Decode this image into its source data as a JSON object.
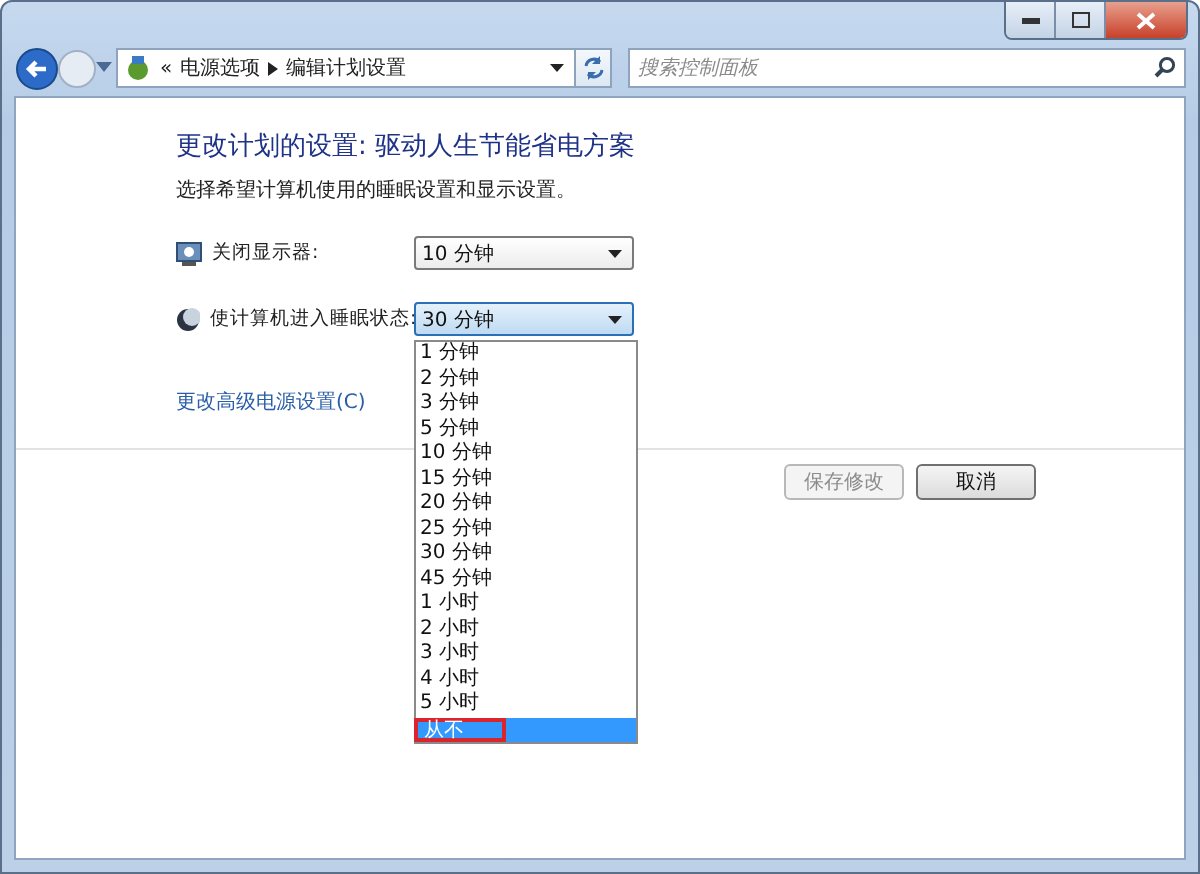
{
  "address_bar": {
    "overflow": "«",
    "crumbs": [
      "电源选项",
      "编辑计划设置"
    ]
  },
  "search": {
    "placeholder": "搜索控制面板"
  },
  "heading": "更改计划的设置: 驱动人生节能省电方案",
  "subtitle": "选择希望计算机使用的睡眠设置和显示设置。",
  "settings": [
    {
      "kind": "display",
      "label": "关闭显示器:",
      "value": "10 分钟",
      "focused": false
    },
    {
      "kind": "sleep",
      "label": "使计算机进入睡眠状态:",
      "value": "30 分钟",
      "focused": true
    }
  ],
  "dropdown": {
    "options": [
      {
        "label": "1 分钟",
        "selected": false,
        "outlined": false
      },
      {
        "label": "2 分钟",
        "selected": false,
        "outlined": false
      },
      {
        "label": "3 分钟",
        "selected": false,
        "outlined": false
      },
      {
        "label": "5 分钟",
        "selected": false,
        "outlined": false
      },
      {
        "label": "10 分钟",
        "selected": false,
        "outlined": false
      },
      {
        "label": "15 分钟",
        "selected": false,
        "outlined": false
      },
      {
        "label": "20 分钟",
        "selected": false,
        "outlined": false
      },
      {
        "label": "25 分钟",
        "selected": false,
        "outlined": false
      },
      {
        "label": "30 分钟",
        "selected": false,
        "outlined": false
      },
      {
        "label": "45 分钟",
        "selected": false,
        "outlined": false
      },
      {
        "label": "1 小时",
        "selected": false,
        "outlined": false
      },
      {
        "label": "2 小时",
        "selected": false,
        "outlined": false
      },
      {
        "label": "3 小时",
        "selected": false,
        "outlined": false
      },
      {
        "label": "4 小时",
        "selected": false,
        "outlined": false
      },
      {
        "label": "5 小时",
        "selected": false,
        "outlined": false
      },
      {
        "label": "从不",
        "selected": true,
        "outlined": true
      }
    ]
  },
  "link": "更改高级电源设置(C)",
  "buttons": [
    {
      "label": "保存修改",
      "disabled": true
    },
    {
      "label": "取消",
      "disabled": false
    }
  ]
}
